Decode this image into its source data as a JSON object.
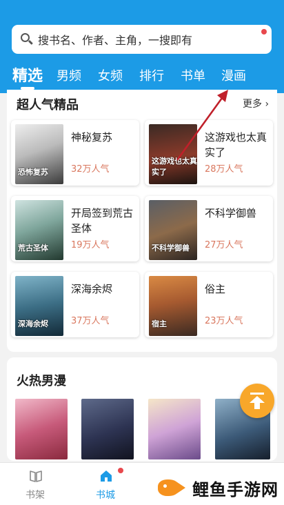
{
  "search": {
    "placeholder": "搜书名、作者、主角，一搜即有"
  },
  "tabs": [
    {
      "label": "精选",
      "active": true
    },
    {
      "label": "男频"
    },
    {
      "label": "女频"
    },
    {
      "label": "排行"
    },
    {
      "label": "书单"
    },
    {
      "label": "漫画"
    }
  ],
  "popular": {
    "title": "超人气精品",
    "more": "更多",
    "books": [
      {
        "title": "神秘复苏",
        "popularity": "32万人气",
        "cover_text": "恐怖复苏"
      },
      {
        "title": "这游戏也太真实了",
        "popularity": "28万人气",
        "cover_text": "这游戏也太真实了"
      },
      {
        "title": "开局签到荒古圣体",
        "popularity": "19万人气",
        "cover_text": "荒古圣体"
      },
      {
        "title": "不科学御兽",
        "popularity": "27万人气",
        "cover_text": "不科学御兽"
      },
      {
        "title": "深海余烬",
        "popularity": "37万人气",
        "cover_text": "深海余烬"
      },
      {
        "title": "俗主",
        "popularity": "23万人气",
        "cover_text": "宿主"
      }
    ]
  },
  "hot_manga": {
    "title": "火热男漫"
  },
  "bottom_nav": [
    {
      "label": "书架",
      "icon": "bookshelf-icon"
    },
    {
      "label": "书城",
      "icon": "home-icon",
      "active": true
    }
  ],
  "watermark": {
    "text": "鲤鱼手游网"
  },
  "colors": {
    "brand": "#1c9be6",
    "popularity": "#d9775e",
    "fab": "#f8a72a",
    "badge": "#e8484d"
  }
}
